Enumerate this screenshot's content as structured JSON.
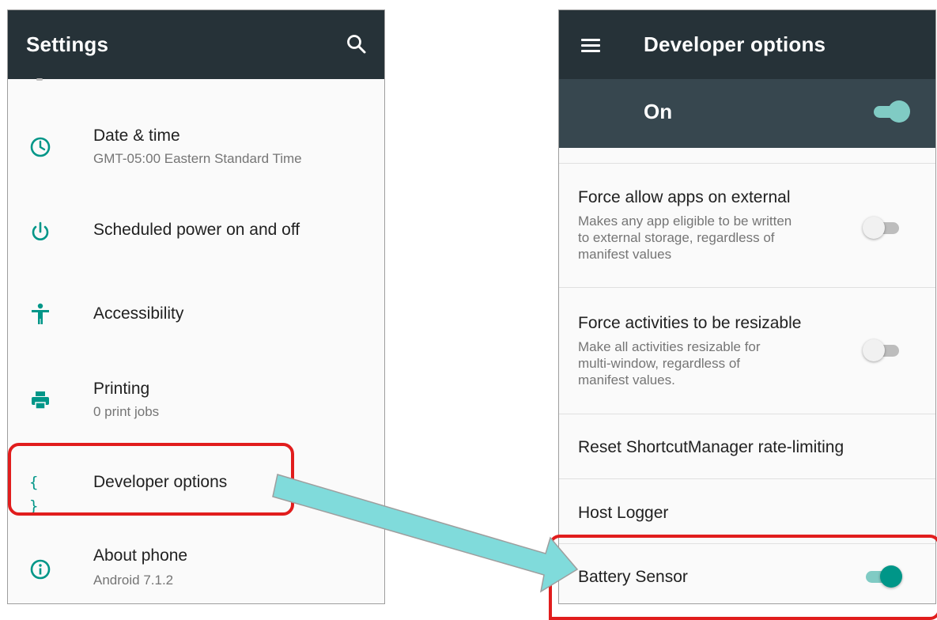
{
  "settings_screen": {
    "title": "Settings",
    "search_icon": "search-icon",
    "items": [
      {
        "icon": "clock-icon",
        "title": "Date & time",
        "subtitle": "GMT-05:00 Eastern Standard Time"
      },
      {
        "icon": "power-icon",
        "title": "Scheduled power on and off",
        "subtitle": ""
      },
      {
        "icon": "accessibility-icon",
        "title": "Accessibility",
        "subtitle": ""
      },
      {
        "icon": "printer-icon",
        "title": "Printing",
        "subtitle": "0 print jobs"
      },
      {
        "icon": "braces-icon",
        "title": "Developer options",
        "subtitle": "",
        "glyph": "{ }"
      },
      {
        "icon": "info-icon",
        "title": "About phone",
        "subtitle": "Android 7.1.2"
      }
    ]
  },
  "developer_screen": {
    "title": "Developer options",
    "menu_icon": "menu-icon",
    "master_switch": {
      "label": "On",
      "state": "on"
    },
    "items": [
      {
        "title": "Force allow apps on external",
        "subtitle_lines": [
          "Makes any app eligible to be written",
          "to external storage, regardless of",
          "manifest values"
        ],
        "switch": "off"
      },
      {
        "title": "Force activities to be resizable",
        "subtitle_lines": [
          "Make all activities resizable for",
          "multi-window, regardless of",
          "manifest values."
        ],
        "switch": "off"
      },
      {
        "title": "Reset ShortcutManager rate-limiting"
      },
      {
        "title": "Host Logger"
      },
      {
        "title": "Battery Sensor",
        "switch": "on"
      }
    ]
  },
  "colors": {
    "appbar": "#263238",
    "subbar": "#37474f",
    "accent": "#009688",
    "highlight": "#e11d1d",
    "arrow_fill": "#80dbdb"
  }
}
